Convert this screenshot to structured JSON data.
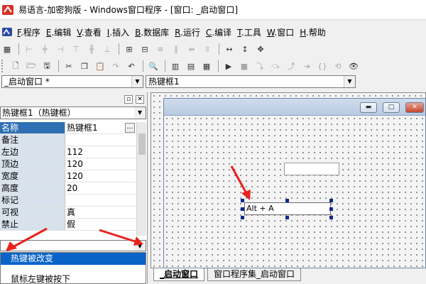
{
  "window": {
    "title": "易语言-加密狗版 - Windows窗口程序 - [窗口: _启动窗口]"
  },
  "menu": [
    {
      "key": "F",
      "label": ".程序"
    },
    {
      "key": "E",
      "label": ".编辑"
    },
    {
      "key": "V",
      "label": ".查看"
    },
    {
      "key": "I",
      "label": ".插入"
    },
    {
      "key": "B",
      "label": ".数据库"
    },
    {
      "key": "R",
      "label": ".运行"
    },
    {
      "key": "C",
      "label": ".编译"
    },
    {
      "key": "T",
      "label": ".工具"
    },
    {
      "key": "W",
      "label": ".窗口"
    },
    {
      "key": "H",
      "label": ".帮助"
    }
  ],
  "toolbar2": {
    "run_icon": "▶",
    "stop_icon": "■"
  },
  "combos": {
    "program_selector": "_启动窗口 *",
    "component_selector": "热键框1"
  },
  "property_panel": {
    "object_selector": "热键框1（热键框）",
    "properties": [
      {
        "name": "名称",
        "value": "热键框1",
        "selected": true
      },
      {
        "name": "备注",
        "value": ""
      },
      {
        "name": "左边",
        "value": "112"
      },
      {
        "name": "顶边",
        "value": "120"
      },
      {
        "name": "宽度",
        "value": "120"
      },
      {
        "name": "高度",
        "value": "20"
      },
      {
        "name": "标记",
        "value": ""
      },
      {
        "name": "可视",
        "value": "真"
      },
      {
        "name": "禁止",
        "value": "假"
      }
    ],
    "more_label": "…",
    "events": [
      "热键被改变",
      "鼠标左键被按下"
    ]
  },
  "designer": {
    "hotkey_text": "Alt + A",
    "caption_buttons": {
      "minimize": "▬",
      "maximize": "□",
      "close": "✕"
    }
  },
  "tabs": [
    "_启动窗口",
    "窗口程序集_启动窗口"
  ],
  "colors": {
    "selection": "#0a64c8",
    "annotation_arrow": "#e8231c",
    "frame": "#6b84a8"
  }
}
